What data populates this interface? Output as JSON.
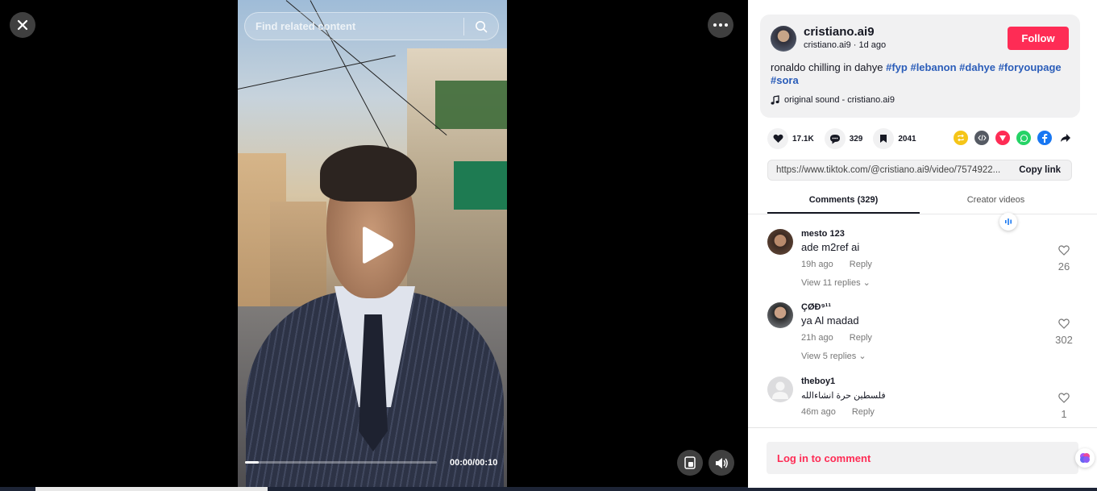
{
  "search": {
    "placeholder": "Find related content"
  },
  "player": {
    "time_display": "00:00/00:10",
    "progress": 0.07
  },
  "author": {
    "display_name": "cristiano.ai9",
    "username": "cristiano.ai9",
    "separator": " · ",
    "posted": "1d ago",
    "follow_label": "Follow"
  },
  "caption": {
    "text": "ronaldo chilling in dahye ",
    "hashtags": [
      "#fyp",
      "#lebanon",
      "#dahye",
      "#foryoupage",
      "#sora"
    ]
  },
  "music": {
    "label": "original sound - cristiano.ai9"
  },
  "actions": {
    "likes": "17.1K",
    "comments": "329",
    "saves": "2041"
  },
  "share": {
    "icons": [
      "repost-icon",
      "embed-icon",
      "send-icon",
      "whatsapp-icon",
      "facebook-icon",
      "share-arrow-icon"
    ]
  },
  "link": {
    "url": "https://www.tiktok.com/@cristiano.ai9/video/7574922...",
    "copy_label": "Copy link"
  },
  "tabs": [
    {
      "label": "Comments (329)",
      "active": true
    },
    {
      "label": "Creator videos",
      "active": false
    }
  ],
  "comments": [
    {
      "user": "mesto 123",
      "text": "ade m2ref ai",
      "time": "19h ago",
      "reply_label": "Reply",
      "view_replies": "View 11 replies",
      "likes": "26"
    },
    {
      "user": "ÇØÐ⁹¹¹",
      "text": "ya Al madad",
      "time": "21h ago",
      "reply_label": "Reply",
      "view_replies": "View 5 replies",
      "likes": "302"
    },
    {
      "user": "theboy1",
      "text": "فلسطين حرة انشاءالله",
      "time": "46m ago",
      "reply_label": "Reply",
      "likes": "1"
    }
  ],
  "login": {
    "label": "Log in to comment"
  },
  "colors": {
    "brand_red": "#fe2c55",
    "hashtag_blue": "#2b5db9",
    "panel_gray": "#f1f1f2"
  }
}
